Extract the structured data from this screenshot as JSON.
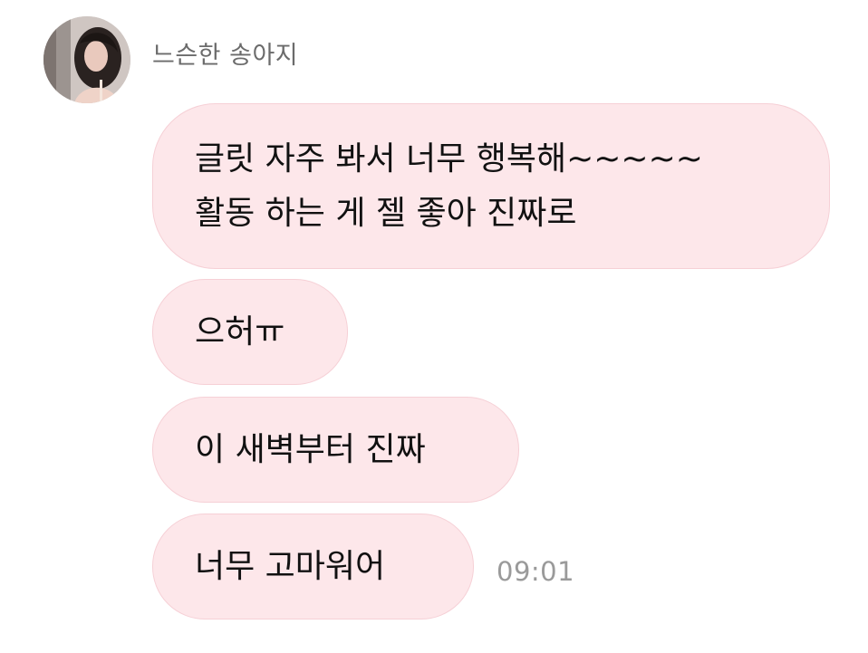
{
  "conversation": {
    "sender_name": "느슨한 송아지",
    "avatar_icon": "profile-photo",
    "messages": [
      {
        "lines": [
          "글릿 자주 봐서 너무 행복해~~~~~",
          "활동 하는 게 젤 좋아 진짜로"
        ]
      },
      {
        "lines": [
          "으허ㅠ"
        ]
      },
      {
        "lines": [
          "이 새벽부터 진짜"
        ]
      },
      {
        "lines": [
          "너무 고마워어"
        ]
      }
    ],
    "last_timestamp": "09:01"
  },
  "colors": {
    "bubble_background": "#fde7ea",
    "bubble_border": "#f6d0d6",
    "sender_text": "#6b6b6b",
    "timestamp_text": "#9a9a9a"
  }
}
